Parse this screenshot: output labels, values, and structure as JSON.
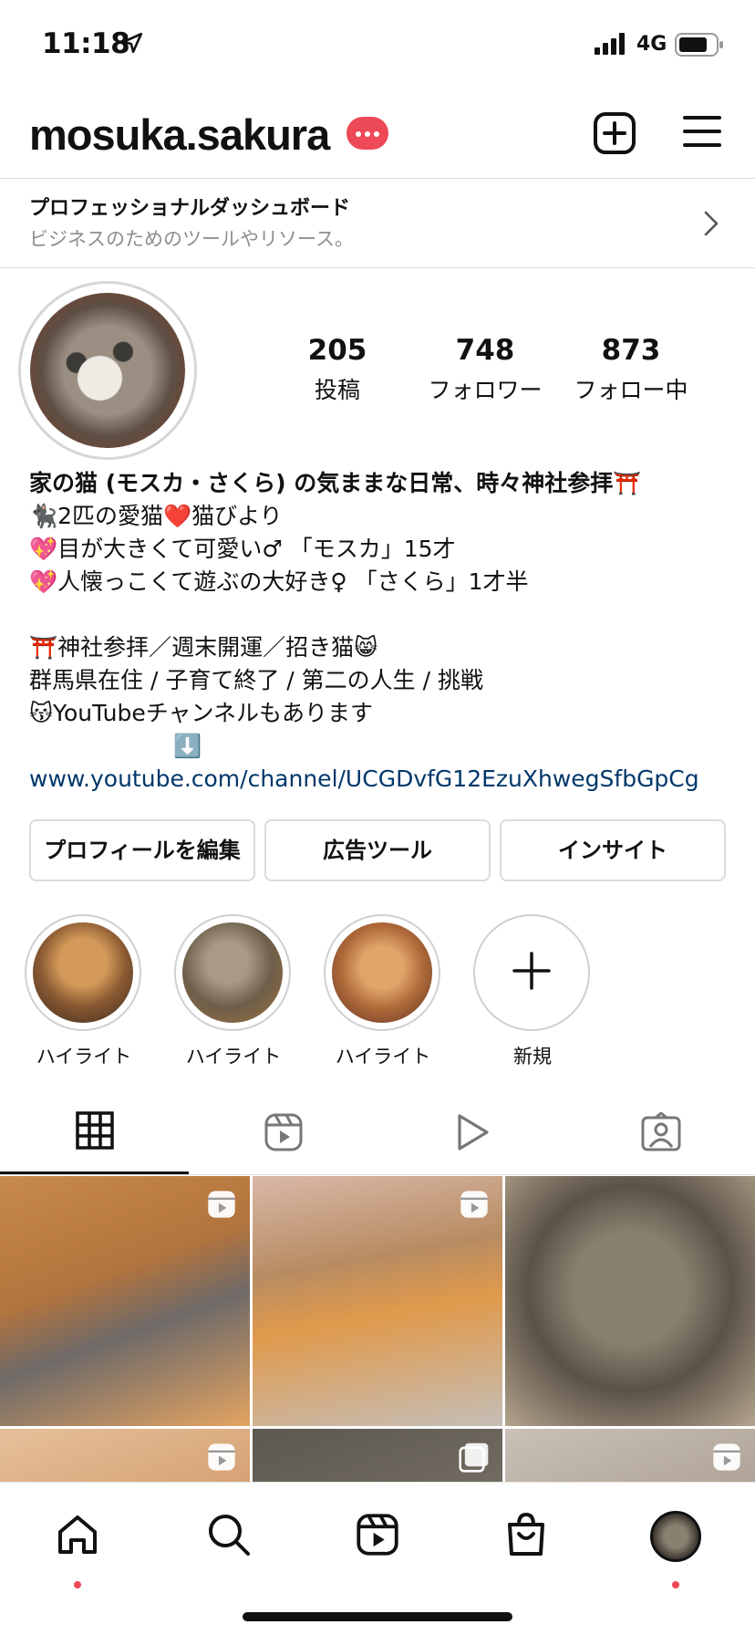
{
  "status_bar": {
    "time": "11:18",
    "network": "4G"
  },
  "header": {
    "username": "mosuka.sakura"
  },
  "dashboard": {
    "title": "プロフェッショナルダッシュボード",
    "subtitle": "ビジネスのためのツールやリソース。"
  },
  "stats": [
    {
      "value": "205",
      "label": "投稿"
    },
    {
      "value": "748",
      "label": "フォロワー"
    },
    {
      "value": "873",
      "label": "フォロー中"
    }
  ],
  "bio": {
    "line1": "家の猫 (モスカ・さくら) の気ままな日常、時々神社参拝⛩️",
    "line2": "🐈‍⬛2匹の愛猫❤️猫びより",
    "line3": "💖目が大きくて可愛い♂ 「モスカ」15才",
    "line4": "💖人懐っこくて遊ぶの大好き♀ 「さくら」1才半",
    "line5": "⛩️神社参拝／週末開運／招き猫😸",
    "line6": "群馬県在住 / 子育て終了 / 第二の人生 / 挑戦",
    "line7": "😽YouTubeチャンネルもあります",
    "line8": "⬇️",
    "link": "www.youtube.com/channel/UCGDvfG12EzuXhwegSfbGpCg"
  },
  "actions": {
    "edit_profile": "プロフィールを編集",
    "ad_tools": "広告ツール",
    "insights": "インサイト"
  },
  "highlights": [
    {
      "label": "ハイライト"
    },
    {
      "label": "ハイライト"
    },
    {
      "label": "ハイライト"
    },
    {
      "label": "新規"
    }
  ],
  "colors": {
    "badge": "#ed4956",
    "link": "#00376b",
    "muted": "#8e8e8e",
    "divider": "#dbdbdb"
  },
  "icons": {
    "status": [
      "location-arrow-icon",
      "signal-icon",
      "battery-icon"
    ],
    "header": [
      "notification-badge-icon",
      "new-post-icon",
      "menu-icon"
    ],
    "tabs": [
      "grid-icon",
      "reels-icon",
      "video-icon",
      "tagged-icon"
    ],
    "bottom_nav": [
      "home-icon",
      "search-icon",
      "reels-icon",
      "shop-icon",
      "profile-avatar"
    ]
  }
}
